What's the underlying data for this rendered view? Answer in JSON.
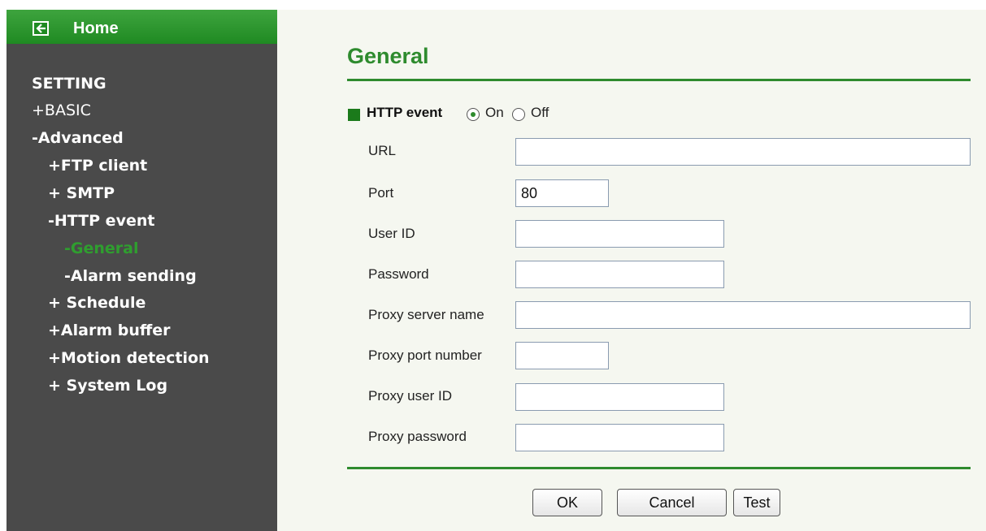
{
  "sidebar": {
    "home_label": "Home",
    "items": [
      {
        "label": "SETTING"
      },
      {
        "label": "+BASIC"
      },
      {
        "label": "-Advanced"
      },
      {
        "label": "+FTP client"
      },
      {
        "label": "+ SMTP"
      },
      {
        "label": "-HTTP event"
      },
      {
        "label": "-General"
      },
      {
        "label": "-Alarm sending"
      },
      {
        "label": "+ Schedule"
      },
      {
        "label": "+Alarm buffer"
      },
      {
        "label": "+Motion detection"
      },
      {
        "label": "+ System Log"
      }
    ]
  },
  "main": {
    "title": "General",
    "http_event": {
      "label": "HTTP event",
      "on_label": "On",
      "off_label": "Off",
      "selected": "On"
    },
    "fields": [
      {
        "label": "URL",
        "value": ""
      },
      {
        "label": "Port",
        "value": "80"
      },
      {
        "label": "User ID",
        "value": ""
      },
      {
        "label": "Password",
        "value": ""
      },
      {
        "label": "Proxy server name",
        "value": ""
      },
      {
        "label": "Proxy port number",
        "value": ""
      },
      {
        "label": "Proxy user ID",
        "value": ""
      },
      {
        "label": "Proxy password",
        "value": ""
      }
    ],
    "buttons": {
      "ok": "OK",
      "cancel": "Cancel",
      "test": "Test"
    }
  },
  "colors": {
    "accent": "#2e8b2e",
    "sidebar_bg": "#4a4a4a",
    "active_nav": "#2f9e2f"
  }
}
